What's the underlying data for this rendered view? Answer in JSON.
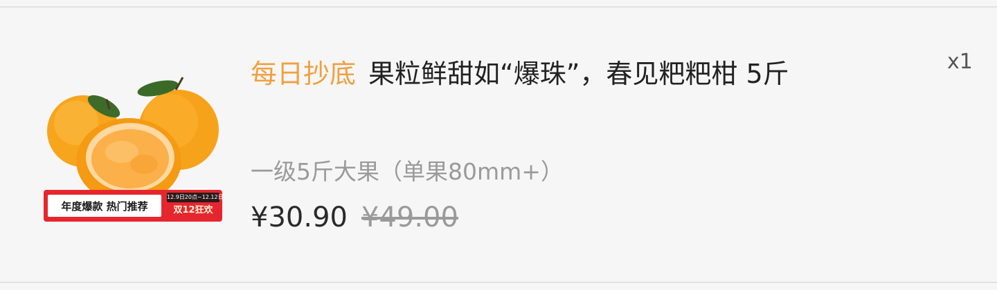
{
  "product": {
    "tag": "每日抄底",
    "title": "果粒鲜甜如“爆珠”，春见粑粑柑 5斤",
    "quantity": "x1",
    "variant": "一级5斤大果（单果80mm+）",
    "price_current": "¥30.90",
    "price_original": "¥49.00",
    "image": {
      "icon": "orange-fruit-image",
      "promo_left": "年度爆款  热门推荐",
      "promo_date": "12.9日20点~12.12日",
      "promo_sale": "双12狂欢",
      "promo_color": "#e6262f"
    }
  },
  "colors": {
    "tag": "#f0a040",
    "text": "#222222",
    "muted": "#9a9a9a",
    "background": "#f6f6f6"
  }
}
